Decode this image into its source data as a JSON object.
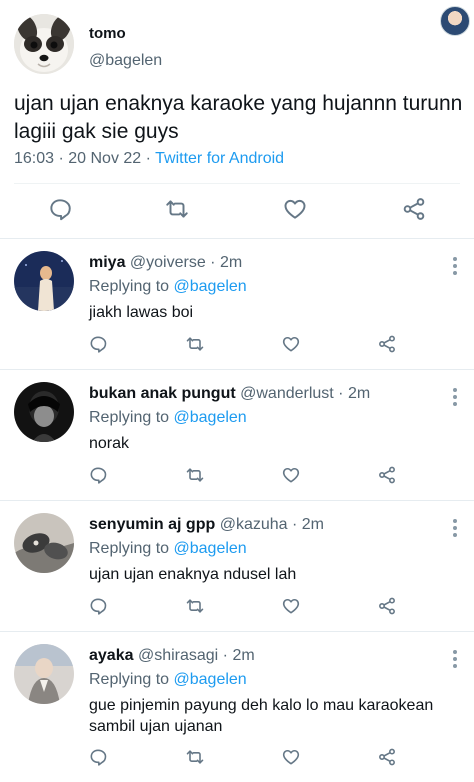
{
  "tweet": {
    "name": "tomo",
    "handle": "@bagelen",
    "text": "ujan ujan enaknya karaoke yang hujannn turunn lagiii gak sie guys",
    "timestamp": "16:03 · 20 Nov 22 · ",
    "source": "Twitter for Android",
    "icons": [
      "reply-icon",
      "retweet-icon",
      "like-icon",
      "share-icon"
    ]
  },
  "replies": [
    {
      "name": "miya",
      "handle": " @yoiverse · 2m",
      "replying_label": "Replying to ",
      "replying_to": "@bagelen",
      "text": "jiakh lawas boi"
    },
    {
      "name": "bukan anak pungut",
      "handle": " @wanderlust · 2m",
      "replying_label": "Replying to ",
      "replying_to": "@bagelen",
      "text": "norak"
    },
    {
      "name": "senyumin aj gpp",
      "handle": " @kazuha · 2m",
      "replying_label": "Replying to ",
      "replying_to": "@bagelen",
      "text": "ujan ujan enaknya ndusel lah"
    },
    {
      "name": "ayaka",
      "handle": " @shirasagi · 2m",
      "replying_label": "Replying to ",
      "replying_to": "@bagelen",
      "text": "gue pinjemin payung deh kalo lo mau karaokean sambil ujan ujanan"
    }
  ],
  "colors": {
    "link": "#1d9bf0",
    "secondary_text": "#536471",
    "icon": "#657786",
    "divider": "#e6ecf0"
  }
}
